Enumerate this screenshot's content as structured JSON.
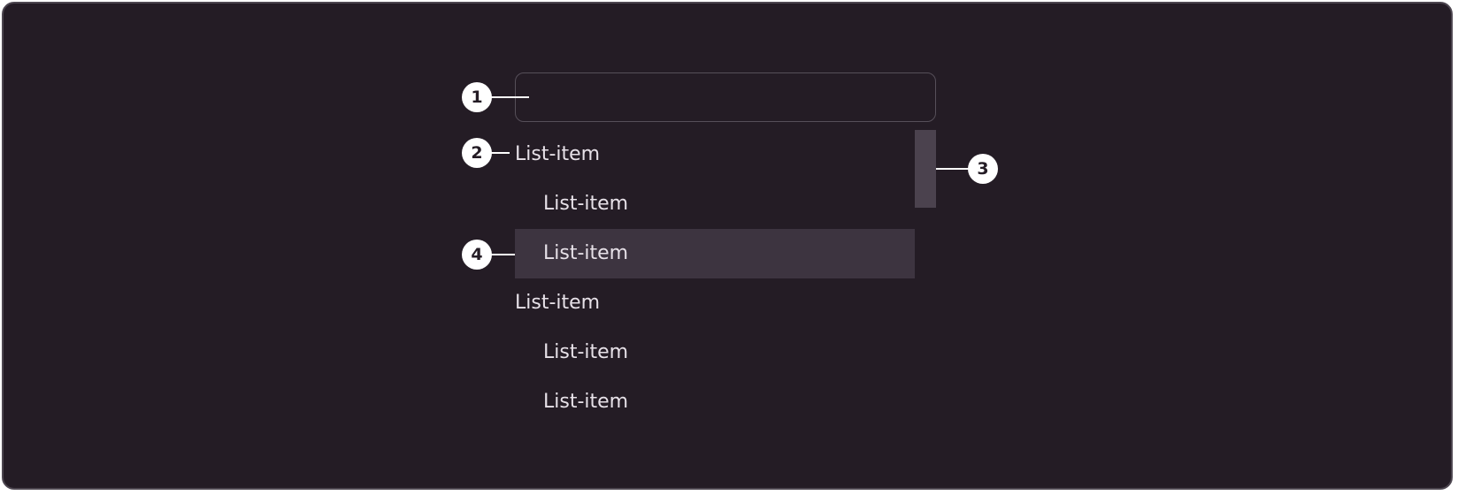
{
  "search": {
    "value": ""
  },
  "list": {
    "items": [
      {
        "label": "List-item",
        "level": 1,
        "selected": false
      },
      {
        "label": "List-item",
        "level": 2,
        "selected": false
      },
      {
        "label": "List-item",
        "level": 2,
        "selected": true
      },
      {
        "label": "List-item",
        "level": 1,
        "selected": false
      },
      {
        "label": "List-item",
        "level": 2,
        "selected": false
      },
      {
        "label": "List-item",
        "level": 2,
        "selected": false
      }
    ]
  },
  "callouts": {
    "search_field": "1",
    "list_item": "2",
    "scrollbar": "3",
    "selected_item": "4"
  },
  "colors": {
    "background": "#241c25",
    "border": "#4d4650",
    "text": "#e7e1e8",
    "selected_background": "#3d3440",
    "scrollbar_thumb": "#4b424e",
    "callout": "#ffffff"
  }
}
